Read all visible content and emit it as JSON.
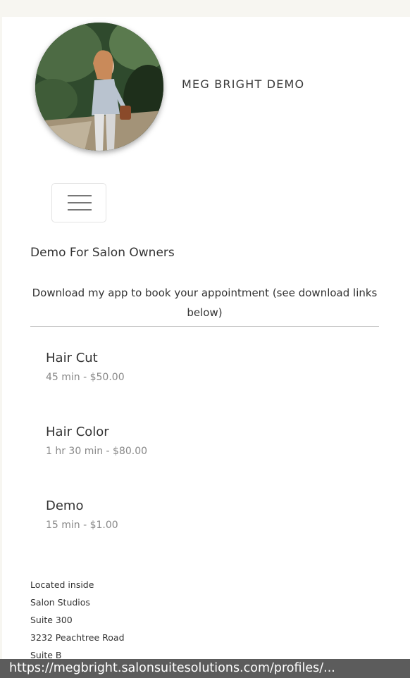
{
  "header": {
    "site_name": "MEG BRIGHT DEMO"
  },
  "nav": {
    "menu_icon": "hamburger-menu-icon"
  },
  "main": {
    "title": "Demo For Salon Owners",
    "intro": "Download my app to book your appointment (see download links below)"
  },
  "services": [
    {
      "name": "Hair Cut",
      "meta": "45 min - $50.00"
    },
    {
      "name": "Hair Color",
      "meta": "1 hr 30 min - $80.00"
    },
    {
      "name": "Demo",
      "meta": "15 min - $1.00"
    }
  ],
  "address": {
    "lines": [
      "Located inside",
      "Salon Studios",
      "Suite 300",
      "3232 Peachtree Road",
      "Suite B"
    ]
  },
  "status_bar": {
    "url": "https://megbright.salonsuitesolutions.com/profiles/..."
  }
}
